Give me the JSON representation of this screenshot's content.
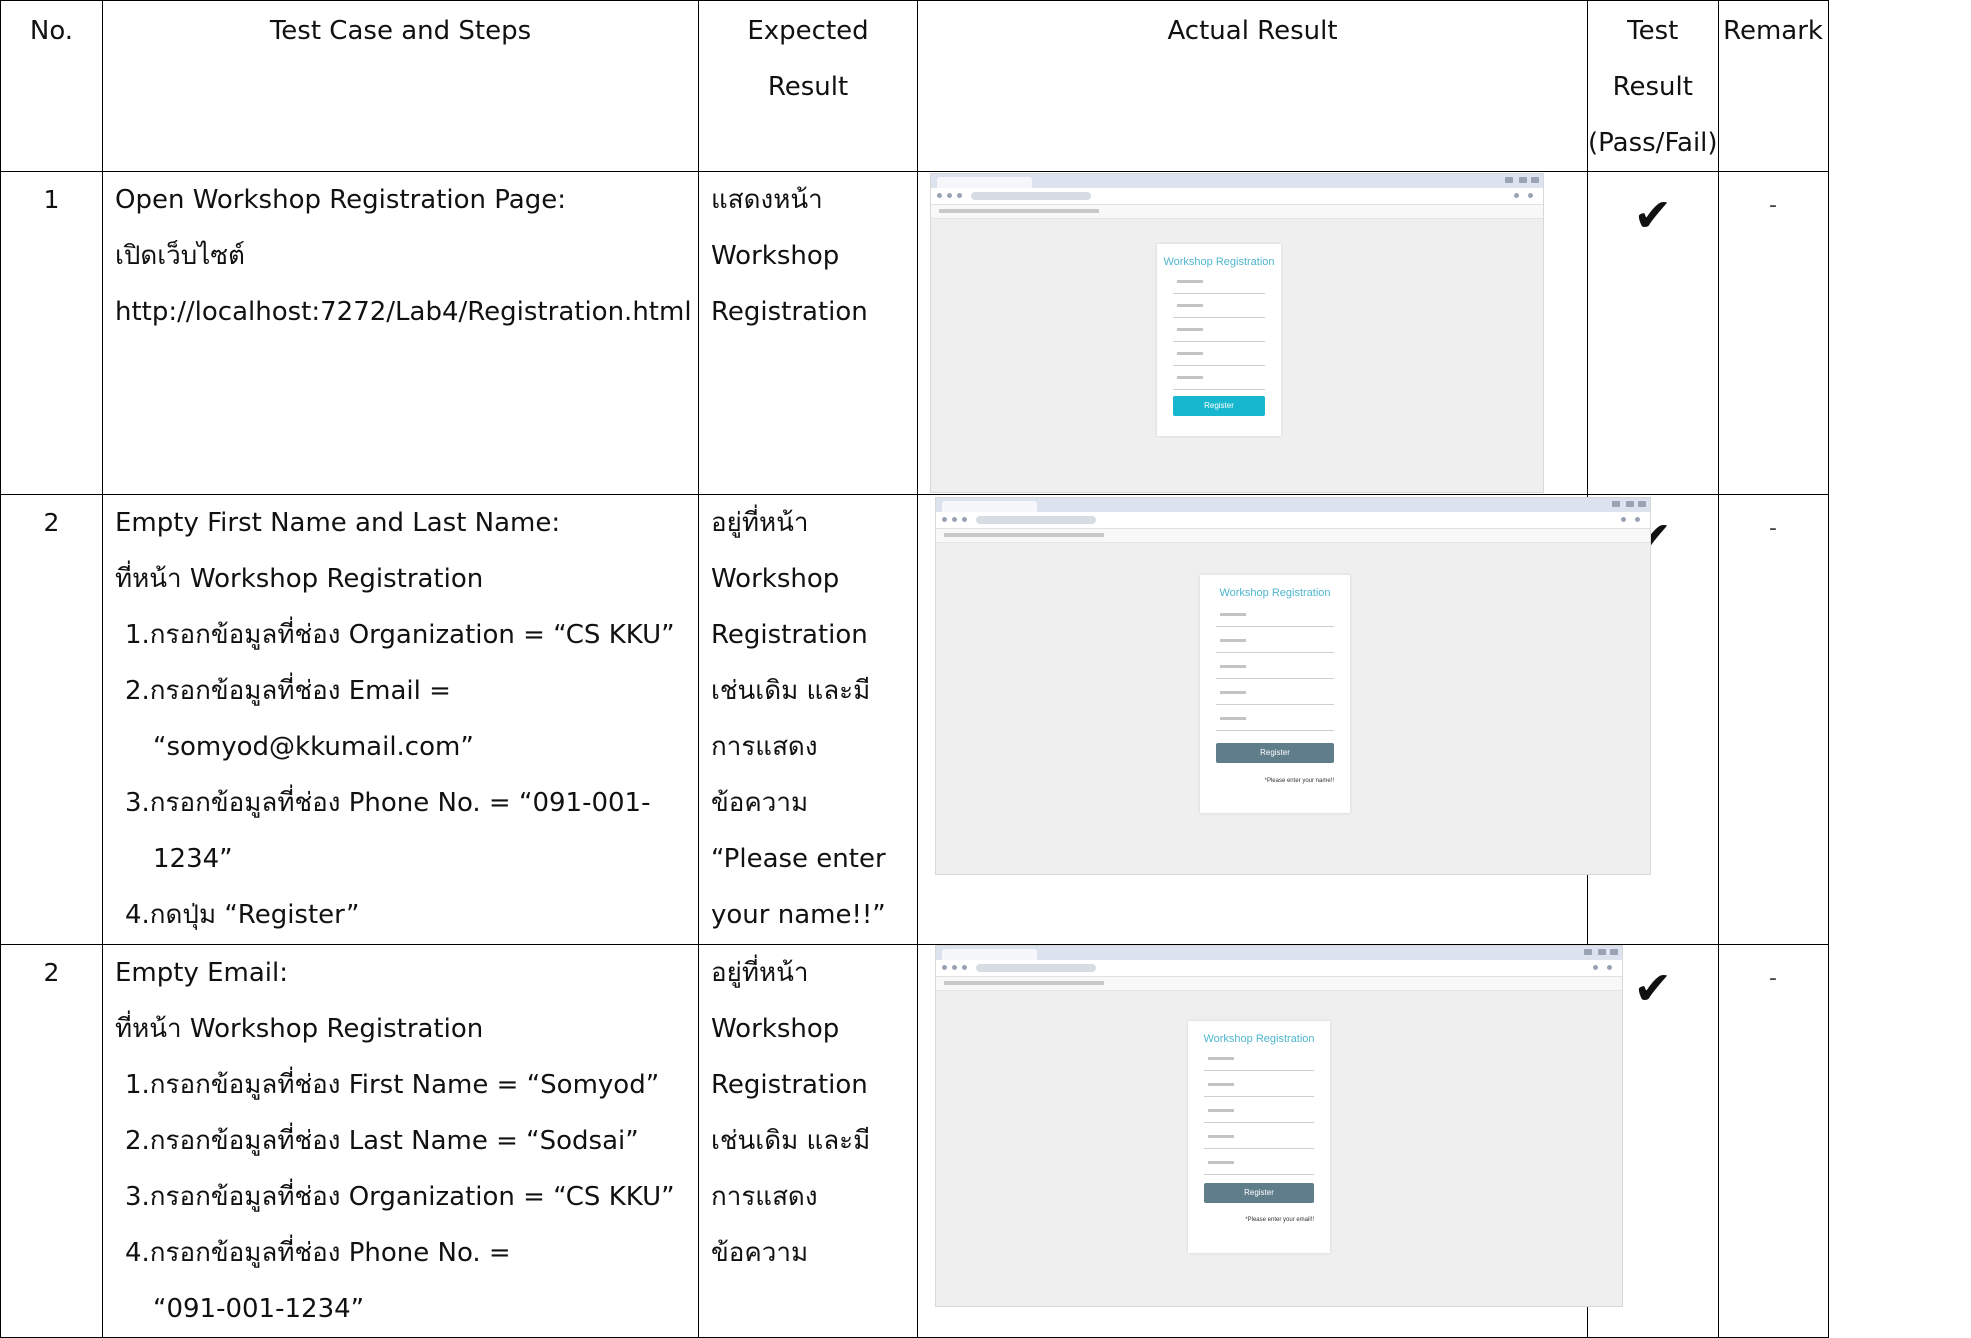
{
  "header": {
    "no": "No.",
    "steps": "Test Case and Steps",
    "expected_1": "Expected",
    "expected_2": "Result",
    "actual": "Actual Result",
    "test_1": "Test",
    "test_2": "Result",
    "test_3": "(Pass/Fail)",
    "remark": "Remark"
  },
  "rows": [
    {
      "no": "1",
      "steps": [
        "Open Workshop Registration Page:",
        "เปิดเว็บไซต์",
        "http://localhost:7272/Lab4/Registration.html"
      ],
      "expected": [
        "แสดงหน้า",
        "Workshop",
        "Registration"
      ],
      "result": "✔",
      "remark": "-",
      "shot": {
        "title": "Workshop Registration",
        "button": "Register",
        "error": ""
      }
    },
    {
      "no": "2",
      "steps": [
        "Empty First Name and Last Name:",
        "ที่หน้า Workshop Registration",
        "1.กรอกข้อมูลที่ช่อง Organization = “CS KKU”",
        "2.กรอกข้อมูลที่ช่อง Email =",
        "“somyod@kkumail.com”",
        "3.กรอกข้อมูลที่ช่อง Phone No. = “091-001-",
        "1234”",
        "4.กดปุ่ม “Register”"
      ],
      "expected": [
        "อยู่ที่หน้า",
        "Workshop",
        "Registration",
        "เช่นเดิม และมี",
        "การแสดง",
        "ข้อความ",
        "“Please enter",
        "your name!!”"
      ],
      "result": "✔",
      "remark": "-",
      "shot": {
        "title": "Workshop Registration",
        "button": "Register",
        "error": "*Please enter your name!!"
      }
    },
    {
      "no": "2",
      "steps": [
        "Empty Email:",
        "ที่หน้า Workshop Registration",
        "1.กรอกข้อมูลที่ช่อง First Name = “Somyod”",
        "2.กรอกข้อมูลที่ช่อง Last Name = “Sodsai”",
        "3.กรอกข้อมูลที่ช่อง Organization = “CS KKU”",
        "4.กรอกข้อมูลที่ช่อง Phone No. =",
        "“091-001-1234”"
      ],
      "expected": [
        "อยู่ที่หน้า",
        "Workshop",
        "Registration",
        "เช่นเดิม และมี",
        "การแสดง",
        "ข้อความ"
      ],
      "result": "✔",
      "remark": "-",
      "shot": {
        "title": "Workshop Registration",
        "button": "Register",
        "error": "*Please enter your email!!"
      }
    }
  ]
}
